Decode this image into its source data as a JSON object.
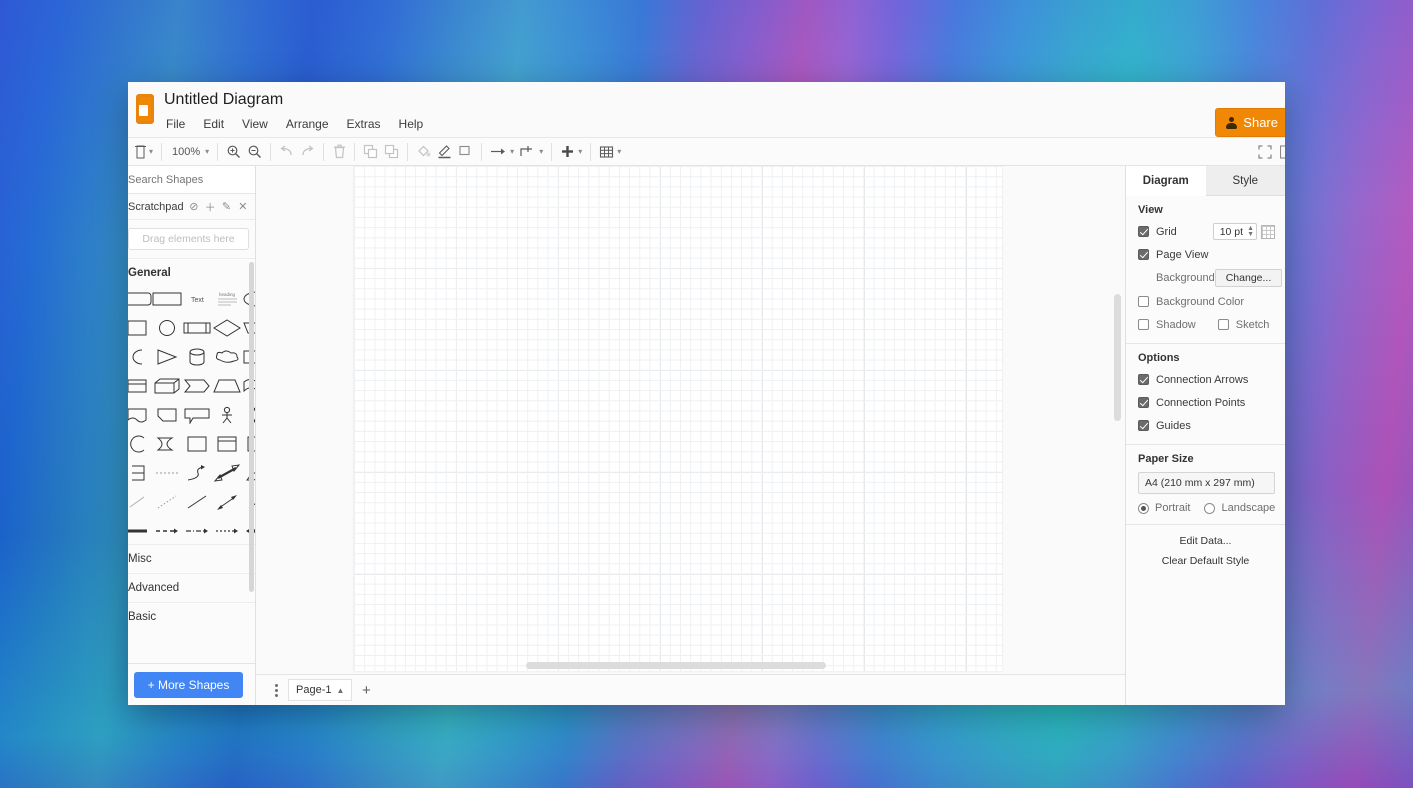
{
  "window": {
    "doc_title": "Untitled Diagram",
    "menus": [
      "File",
      "Edit",
      "View",
      "Arrange",
      "Extras",
      "Help"
    ],
    "share_label": "Share",
    "share_color": "#f08705"
  },
  "toolbar": {
    "view_dropdown": "view-dropdown",
    "zoom_level": "100%",
    "items": [
      {
        "name": "zoom-in-icon",
        "label": ""
      },
      {
        "name": "zoom-out-icon",
        "label": ""
      },
      {
        "name": "undo-icon",
        "label": ""
      },
      {
        "name": "redo-icon",
        "label": ""
      },
      {
        "name": "delete-icon",
        "label": ""
      },
      {
        "name": "to-front-icon",
        "label": ""
      },
      {
        "name": "to-back-icon",
        "label": ""
      },
      {
        "name": "fill-color-icon",
        "label": ""
      },
      {
        "name": "line-color-icon",
        "label": ""
      },
      {
        "name": "shadow-icon",
        "label": ""
      },
      {
        "name": "connection-arrow-icon",
        "label": ""
      },
      {
        "name": "waypoints-icon",
        "label": ""
      },
      {
        "name": "insert-icon",
        "label": ""
      },
      {
        "name": "table-icon",
        "label": ""
      },
      {
        "name": "fullscreen-icon",
        "label": ""
      }
    ]
  },
  "sidebar": {
    "search_placeholder": "Search Shapes",
    "scratchpad_title": "Scratchpad",
    "scratchpad_icons": [
      "help-icon",
      "add-icon",
      "edit-icon",
      "close-icon"
    ],
    "drop_hint": "Drag elements here",
    "general_section": "General",
    "sections": [
      "Misc",
      "Advanced",
      "Basic"
    ],
    "more_shapes_label": "+ More Shapes"
  },
  "format_panel": {
    "tabs": [
      {
        "label": "Diagram",
        "active": true
      },
      {
        "label": "Style",
        "active": false
      }
    ],
    "view": {
      "title": "View",
      "grid_label": "Grid",
      "grid_checked": true,
      "grid_size": "10 pt",
      "page_view_label": "Page View",
      "page_view_checked": true,
      "background_label": "Background",
      "change_label": "Change...",
      "background_color_label": "Background Color",
      "background_color_checked": false,
      "shadow_label": "Shadow",
      "shadow_checked": false,
      "sketch_label": "Sketch",
      "sketch_checked": false
    },
    "options": {
      "title": "Options",
      "items": [
        {
          "label": "Connection Arrows",
          "checked": true
        },
        {
          "label": "Connection Points",
          "checked": true
        },
        {
          "label": "Guides",
          "checked": true
        }
      ]
    },
    "paper": {
      "title": "Paper Size",
      "size": "A4 (210 mm x 297 mm)",
      "portrait_label": "Portrait",
      "landscape_label": "Landscape",
      "orientation": "Portrait"
    },
    "buttons": [
      {
        "label": "Edit Data..."
      },
      {
        "label": "Clear Default Style"
      }
    ]
  },
  "statusbar": {
    "menu_icon": "page-menu-icon",
    "page_tab": "Page-1",
    "add_page_label": "+"
  }
}
